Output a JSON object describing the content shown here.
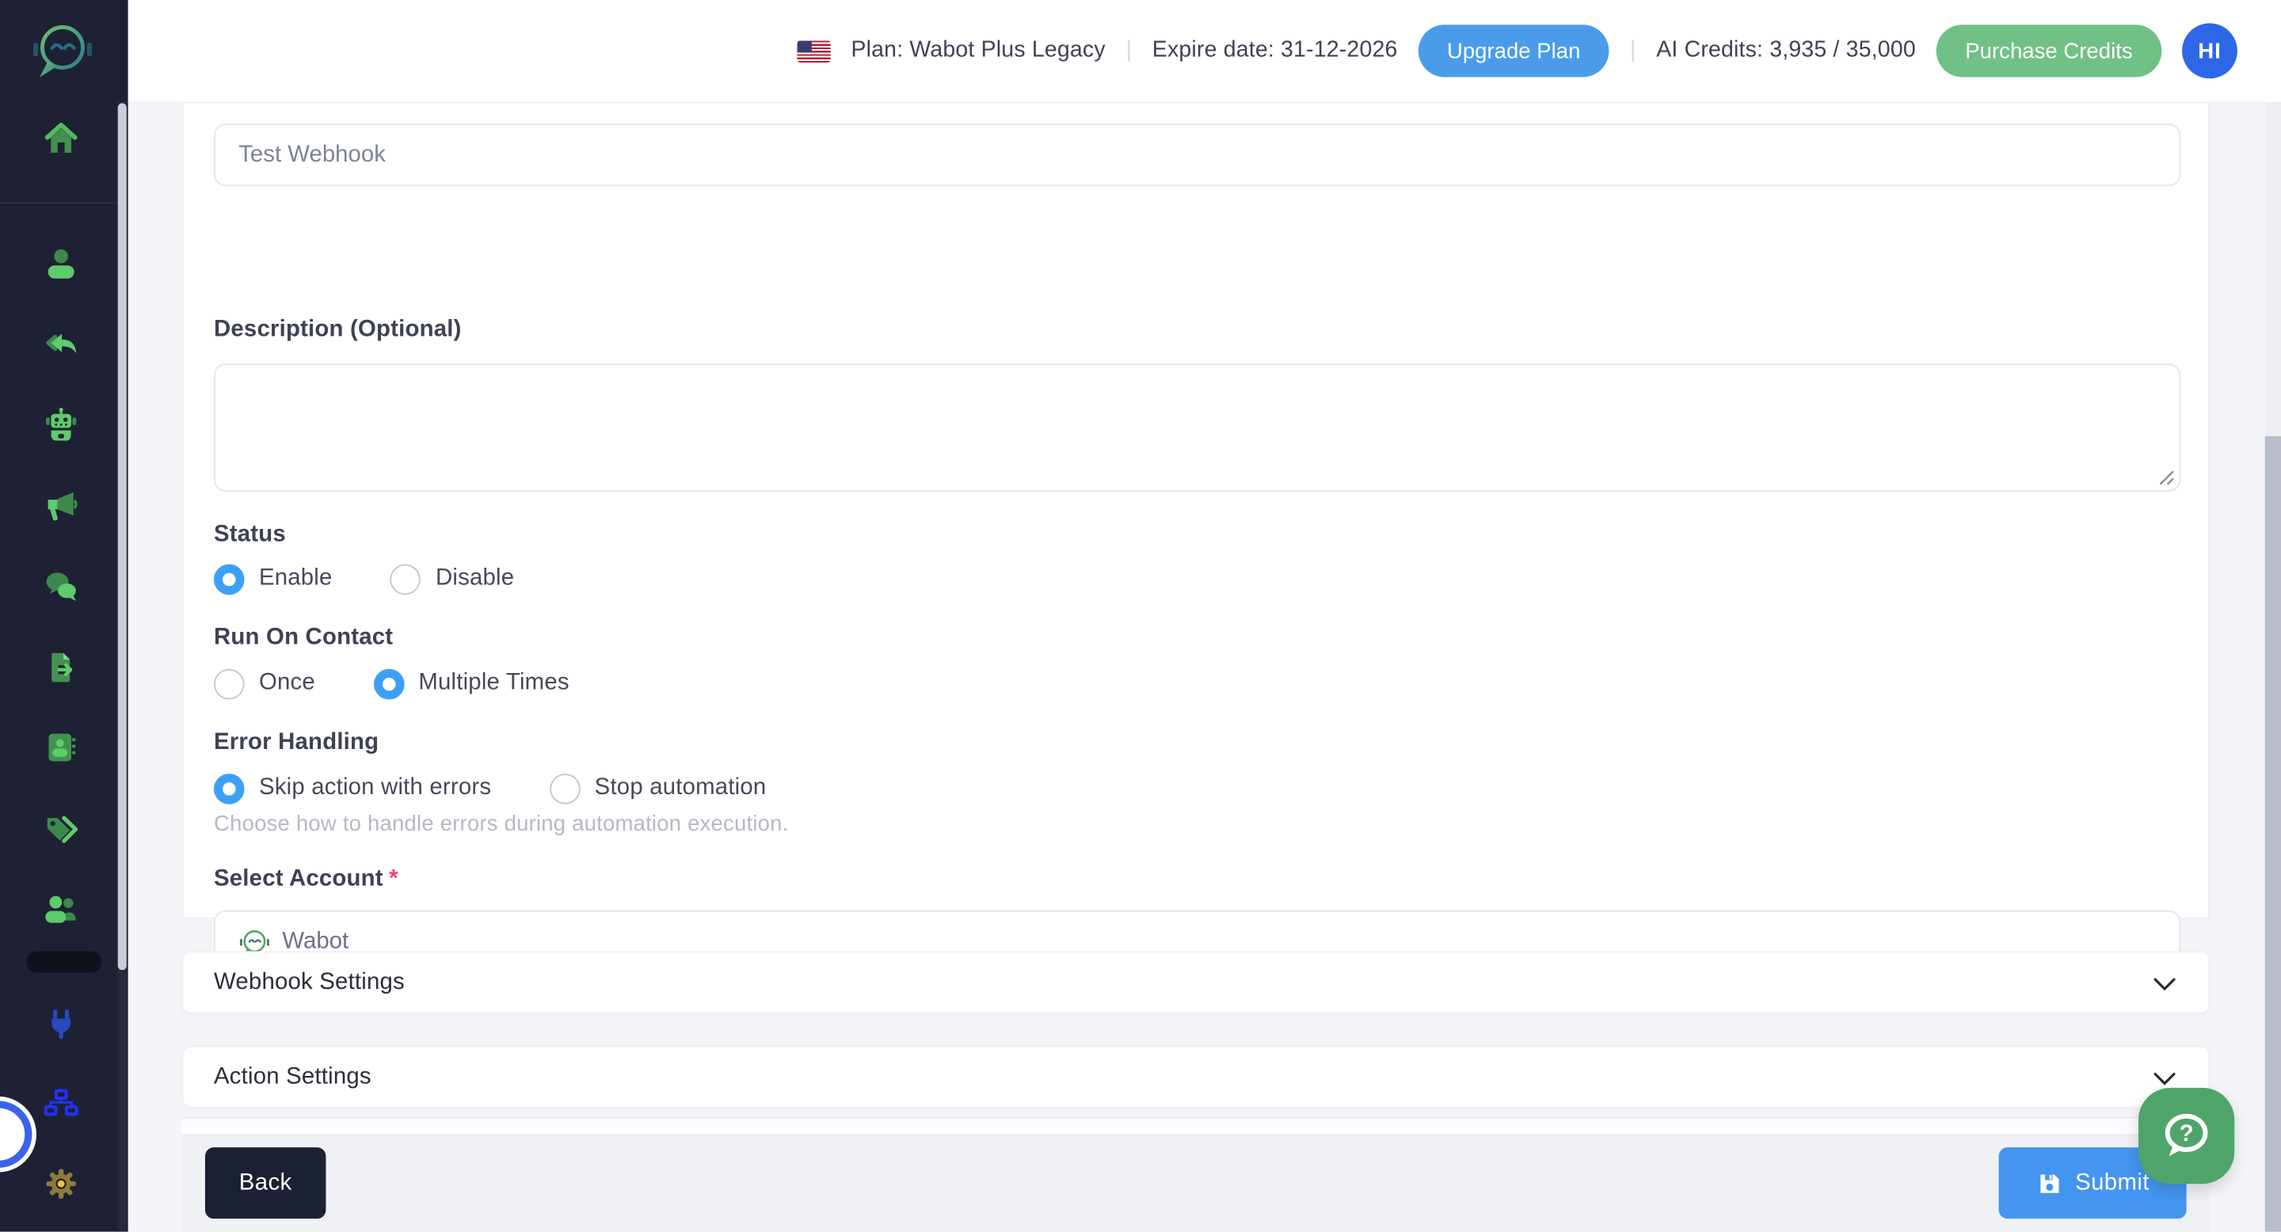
{
  "header": {
    "plan": "Plan: Wabot Plus Legacy",
    "separator": "|",
    "expire": "Expire date: 31-12-2026",
    "upgrade_button": "Upgrade Plan",
    "credits": "AI Credits: 3,935 / 35,000",
    "purchase_button": "Purchase Credits",
    "avatar": "HI"
  },
  "sidebar": {
    "icons": [
      "wabot-logo",
      "home",
      "user",
      "reply",
      "robot",
      "megaphone",
      "chats",
      "export-document",
      "contacts-book",
      "tags",
      "users",
      "plug",
      "sitemap",
      "gear"
    ]
  },
  "form": {
    "name_value": "Test Webhook",
    "description_label": "Description (Optional)",
    "description_value": "",
    "status_label": "Status",
    "status_options": [
      "Enable",
      "Disable"
    ],
    "status_selected": "Enable",
    "run_label": "Run On Contact",
    "run_options": [
      "Once",
      "Multiple Times"
    ],
    "run_selected": "Multiple Times",
    "error_label": "Error Handling",
    "error_options": [
      "Skip action with errors",
      "Stop automation"
    ],
    "error_selected": "Skip action with errors",
    "error_helper": "Choose how to handle errors during automation execution.",
    "account_label": "Select Account",
    "required_mark": "*",
    "account_value": "Wabot"
  },
  "sections": {
    "webhook": "Webhook Settings",
    "action": "Action Settings"
  },
  "footer": {
    "back": "Back",
    "submit": "Submit"
  },
  "fab": {
    "icon_char": "?"
  },
  "colors": {
    "sidebar_bg": "#1e2133",
    "green_bright": "#5ecb6c",
    "green_dark": "#3c8a4b",
    "radio_blue": "#3da0f6",
    "upgrade_blue": "#4a9ceb",
    "submit_blue": "#4495ef",
    "purchase_green": "#71c086",
    "avatar_blue": "#2d67e6",
    "back_dark": "#1c2033",
    "fab_green": "#4fa569",
    "danger": "#f1416c"
  }
}
